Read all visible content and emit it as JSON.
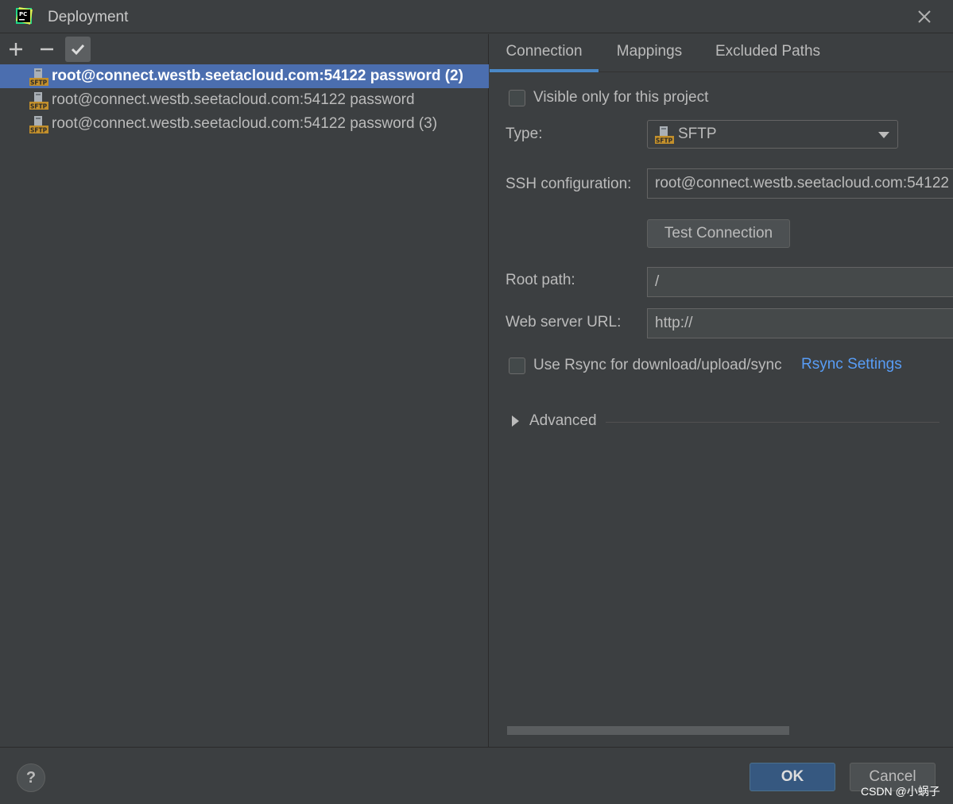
{
  "window": {
    "title": "Deployment"
  },
  "colors": {
    "background": "#3c3f41",
    "selection": "#4b6eaf",
    "accent": "#4a88c7",
    "link": "#589df6",
    "ok_button": "#365880"
  },
  "sidebar": {
    "toolbar": {
      "add_icon": "plus-icon",
      "remove_icon": "minus-icon",
      "default_icon": "checkmark-icon"
    },
    "servers": [
      {
        "label": "root@connect.westb.seetacloud.com:54122 password (2)",
        "icon": "sftp-icon",
        "selected": true
      },
      {
        "label": "root@connect.westb.seetacloud.com:54122 password",
        "icon": "sftp-icon",
        "selected": false
      },
      {
        "label": "root@connect.westb.seetacloud.com:54122 password (3)",
        "icon": "sftp-icon",
        "selected": false
      }
    ]
  },
  "tabs": [
    {
      "label": "Connection",
      "active": true
    },
    {
      "label": "Mappings",
      "active": false
    },
    {
      "label": "Excluded Paths",
      "active": false
    }
  ],
  "connection": {
    "visible_only_label": "Visible only for this project",
    "visible_only_checked": false,
    "type_label": "Type:",
    "type_value": "SFTP",
    "ssh_label": "SSH configuration:",
    "ssh_value": "root@connect.westb.seetacloud.com:54122",
    "test_button": "Test Connection",
    "root_path_label": "Root path:",
    "root_path_value": "/",
    "web_url_label": "Web server URL:",
    "web_url_value": "http://",
    "rsync_label": "Use Rsync for download/upload/sync",
    "rsync_checked": false,
    "rsync_settings_link": "Rsync Settings",
    "advanced_label": "Advanced"
  },
  "footer": {
    "help": "?",
    "ok": "OK",
    "cancel": "Cancel",
    "watermark": "CSDN @小蜗子"
  }
}
